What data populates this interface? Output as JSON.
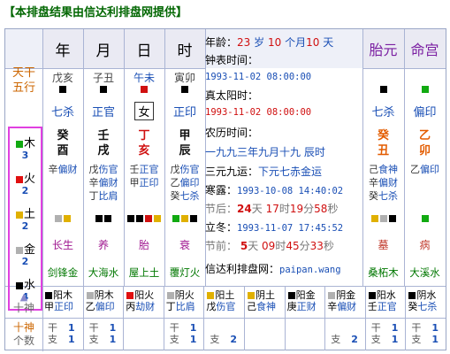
{
  "banner": "【本排盘结果由信达利排盘网提供】",
  "headers": {
    "year": "年",
    "month": "月",
    "day": "日",
    "hour": "时",
    "taiyuan": "胎元",
    "minggong": "命宫"
  },
  "row_labels": {
    "stems_branches_1": "天干",
    "stems_branches_2": "五行",
    "ten_gods": "十神",
    "count_1": "十神",
    "count_2": "个数"
  },
  "pillars": [
    {
      "ganzhi": "戊亥",
      "color": "#000000",
      "top_god": "七杀",
      "stem": "癸",
      "branch": "酉",
      "hidden": [
        {
          "t": "辛",
          "g": "偏财"
        }
      ],
      "stage": "长生",
      "nayin": "剑锋金"
    },
    {
      "ganzhi": "子丑",
      "color": "#000000",
      "top_god": "正官",
      "stem": "壬",
      "branch": "戌",
      "hidden": [
        {
          "t": "戊",
          "g": "伤官"
        },
        {
          "t": "辛",
          "g": "偏财"
        },
        {
          "t": "丁",
          "g": "比肩"
        }
      ],
      "stage": "养",
      "nayin": "大海水"
    },
    {
      "ganzhi": "午未",
      "color": "#d01010",
      "top_god": "女",
      "stem": "丁",
      "branch": "亥",
      "hidden": [
        {
          "t": "壬",
          "g": "正官"
        },
        {
          "t": "甲",
          "g": "正印"
        }
      ],
      "stage": "胎",
      "nayin": "屋上土"
    },
    {
      "ganzhi": "寅卯",
      "color": "#000000",
      "top_god": "正印",
      "stem": "甲",
      "branch": "辰",
      "hidden": [
        {
          "t": "戊",
          "g": "伤官"
        },
        {
          "t": "乙",
          "g": "偏印"
        },
        {
          "t": "癸",
          "g": "七杀"
        }
      ],
      "stage": "衰",
      "nayin": "覆灯火"
    }
  ],
  "taiyuan": {
    "top_god": "七杀",
    "stem": "癸",
    "branch": "丑",
    "hidden": [
      {
        "t": "己",
        "g": "食神"
      },
      {
        "t": "辛",
        "g": "偏财"
      },
      {
        "t": "癸",
        "g": "七杀"
      }
    ],
    "stage": "墓",
    "nayin": "桑柘木"
  },
  "minggong": {
    "top_god": "偏印",
    "stem": "乙",
    "branch": "卯",
    "hidden": [
      {
        "t": "乙",
        "g": "偏印"
      }
    ],
    "stage": "病",
    "nayin": "大溪水"
  },
  "info": {
    "age_label": "年龄：",
    "age_years": "23",
    "age_unit_y": "岁",
    "age_months": "10",
    "age_unit_m": "个月",
    "age_days": "10",
    "age_unit_d": "天",
    "clock_label": "钟表时间：",
    "clock_value": "1993-11-02 08:00:00",
    "solar_label": "真太阳时：",
    "solar_value": "1993-11-02 08:00:00",
    "lunar_label": "农历时间：",
    "lunar_value": "一九九三年九月十九 辰时",
    "yuanyun_label": "三元九运：",
    "yuanyun_value": "下元七赤金运",
    "hanlu_label": "寒露：",
    "hanlu_value": "1993-10-08 14:40:02",
    "after_label": "节后：",
    "after_d": "24",
    "after_d_u": "天",
    "after_h": "17",
    "after_h_u": "时",
    "after_m": "19",
    "after_m_u": "分",
    "after_s": "58",
    "after_s_u": "秒",
    "lidong_label": "立冬：",
    "lidong_value": "1993-11-07 17:45:52",
    "before_label": "节前：",
    "before_d": "5",
    "before_d_u": "天",
    "before_h": "09",
    "before_h_u": "时",
    "before_m": "45",
    "before_m_u": "分",
    "before_s": "33",
    "before_s_u": "秒",
    "site_label": "信达利排盘网：",
    "site_value": "paipan.wang"
  },
  "wuxing": [
    {
      "name": "木",
      "count": "3",
      "color": "#11aa11"
    },
    {
      "name": "火",
      "count": "2",
      "color": "#e01010"
    },
    {
      "name": "土",
      "count": "2",
      "color": "#e0b000"
    },
    {
      "name": "金",
      "count": "2",
      "color": "#b0b0b0"
    },
    {
      "name": "水",
      "count": "4",
      "color": "#000000"
    }
  ],
  "ten_gods_row": [
    {
      "stem": "甲",
      "el": "阳木",
      "god": "正印",
      "color": "#000000"
    },
    {
      "stem": "乙",
      "el": "阴木",
      "god": "偏印",
      "color": "#b0b0b0"
    },
    {
      "stem": "丙",
      "el": "阳火",
      "god": "劫财",
      "color": "#e01010"
    },
    {
      "stem": "丁",
      "el": "阴火",
      "god": "比肩",
      "color": "#b0b0b0"
    },
    {
      "stem": "戊",
      "el": "阳土",
      "god": "伤官",
      "color": "#e0b000"
    },
    {
      "stem": "己",
      "el": "阴土",
      "god": "食神",
      "color": "#e0b000"
    },
    {
      "stem": "庚",
      "el": "阳金",
      "god": "正财",
      "color": "#000000"
    },
    {
      "stem": "辛",
      "el": "阴金",
      "god": "偏财",
      "color": "#b0b0b0"
    },
    {
      "stem": "壬",
      "el": "阳水",
      "god": "正官",
      "color": "#000000"
    },
    {
      "stem": "癸",
      "el": "阴水",
      "god": "七杀",
      "color": "#000000"
    }
  ],
  "counts_row": [
    {
      "g": "干",
      "gv": "1",
      "z": "支",
      "zv": "1"
    },
    {
      "g": "干",
      "gv": "1",
      "z": "支",
      "zv": "1"
    },
    {
      "g": "",
      "gv": "",
      "z": "",
      "zv": ""
    },
    {
      "g": "干",
      "gv": "1",
      "z": "支",
      "zv": "1"
    },
    {
      "g": "",
      "gv": "",
      "z": "支",
      "zv": "2"
    },
    {
      "g": "",
      "gv": "",
      "z": "",
      "zv": ""
    },
    {
      "g": "",
      "gv": "",
      "z": "",
      "zv": ""
    },
    {
      "g": "",
      "gv": "",
      "z": "支",
      "zv": "2"
    },
    {
      "g": "干",
      "gv": "1",
      "z": "支",
      "zv": "1"
    },
    {
      "g": "干",
      "gv": "1",
      "z": "支",
      "zv": "1"
    }
  ],
  "triangle_label": "▲"
}
